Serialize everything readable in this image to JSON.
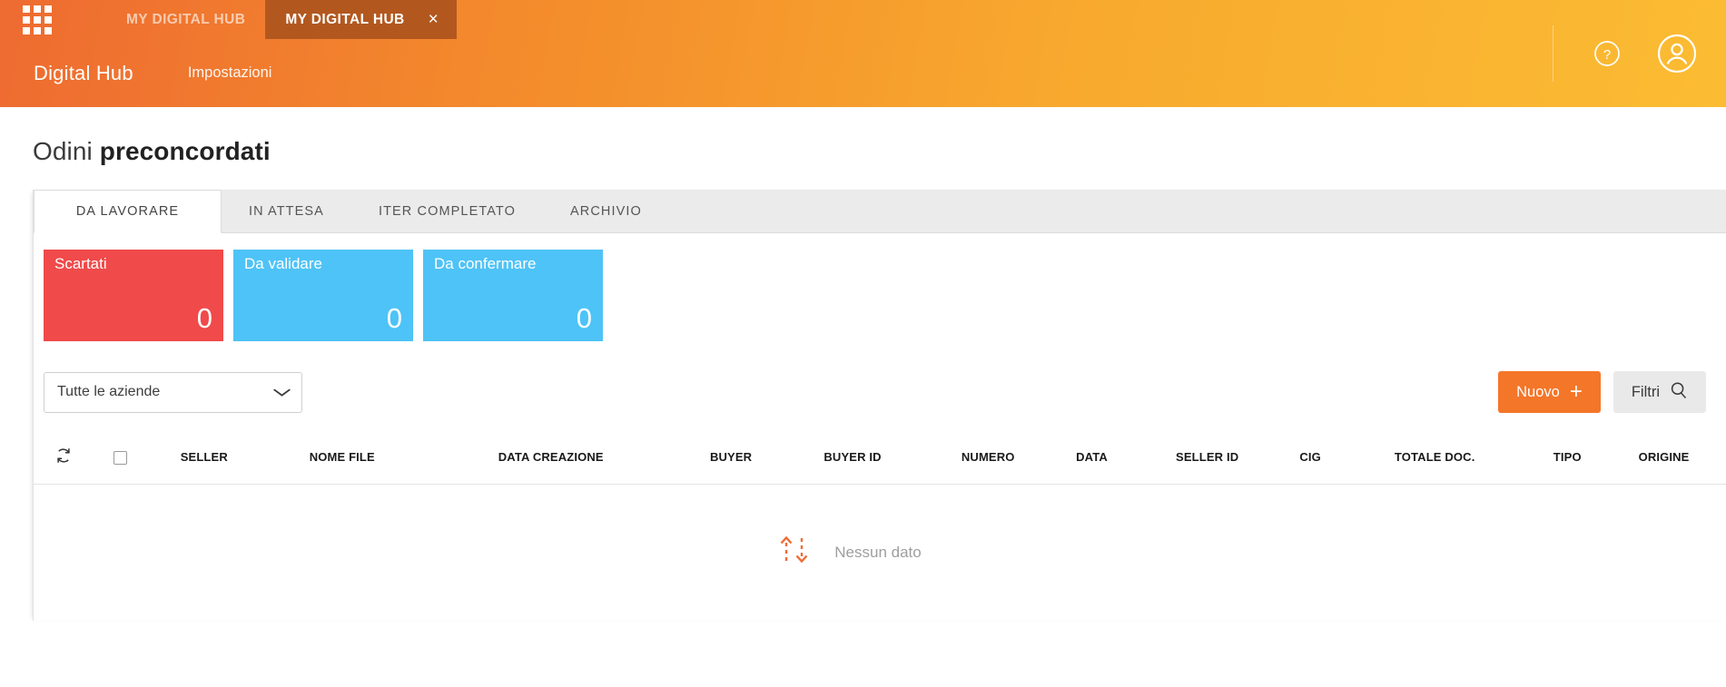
{
  "header": {
    "apps_icon": "apps-grid-icon",
    "window_tabs": [
      {
        "label": "MY DIGITAL HUB",
        "active": false
      },
      {
        "label": "MY DIGITAL HUB",
        "active": true,
        "close_label": "×"
      }
    ],
    "brand": "Digital Hub",
    "nav": [
      {
        "label": "Impostazioni"
      }
    ],
    "help_icon": "help-circle-icon",
    "account_icon": "user-account-icon",
    "gradient_from": "#ee6b31",
    "gradient_to": "#fbbc33",
    "active_tab_color": "#b2581f"
  },
  "page": {
    "title_light": "Odini",
    "title_bold": "preconcordati"
  },
  "tabs": [
    {
      "label": "DA LAVORARE",
      "active": true
    },
    {
      "label": "IN ATTESA",
      "active": false
    },
    {
      "label": "ITER COMPLETATO",
      "active": false
    },
    {
      "label": "ARCHIVIO",
      "active": false
    }
  ],
  "kpi_cards": [
    {
      "label": "Scartati",
      "value": "0",
      "color": "#f04a4a"
    },
    {
      "label": "Da validare",
      "value": "0",
      "color": "#4ec3f7"
    },
    {
      "label": "Da confermare",
      "value": "0",
      "color": "#4ec3f7"
    }
  ],
  "toolbar": {
    "company_select": {
      "value": "Tutte le aziende",
      "chevron": "⌄"
    },
    "new_button": {
      "label": "Nuovo",
      "icon": "plus-icon",
      "glyph": "+",
      "color": "#f47629"
    },
    "filter_button": {
      "label": "Filtri",
      "icon": "search-icon"
    }
  },
  "table": {
    "refresh_icon": "refresh-icon",
    "select_all_icon": "checkbox-icon",
    "columns": [
      "SELLER",
      "NOME FILE",
      "DATA CREAZIONE",
      "BUYER",
      "BUYER ID",
      "NUMERO",
      "DATA",
      "SELLER ID",
      "CIG",
      "TOTALE DOC.",
      "TIPO",
      "ORIGINE"
    ],
    "rows": [],
    "empty_state": {
      "icon": "no-data-arrows-icon",
      "text": "Nessun dato"
    }
  }
}
